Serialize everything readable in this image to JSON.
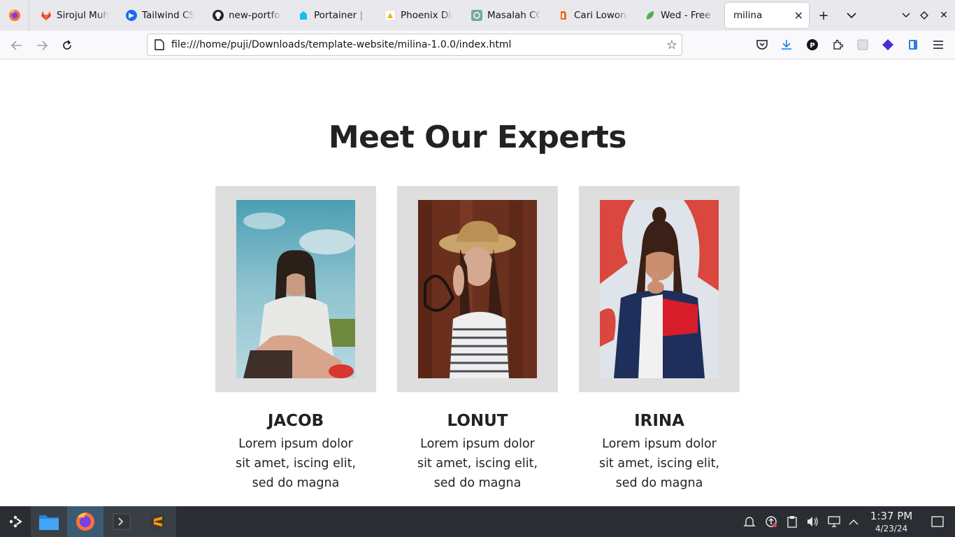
{
  "browser": {
    "tabs": [
      {
        "title": "Sirojul Muhtar",
        "favicon": "gitlab-icon",
        "color": "#e24329"
      },
      {
        "title": "Tailwind CSS",
        "favicon": "play-circle-icon",
        "color": "#1a6df2"
      },
      {
        "title": "new-portfolio",
        "favicon": "github-icon",
        "color": "#24292f"
      },
      {
        "title": "Portainer | lo",
        "favicon": "portainer-icon",
        "color": "#13bef9"
      },
      {
        "title": "Phoenix Digit",
        "favicon": "phoenix-icon",
        "color": "#f6b01e"
      },
      {
        "title": "Masalah COR",
        "favicon": "chatgpt-icon",
        "color": "#74aa9c"
      },
      {
        "title": "Cari Lowonga",
        "favicon": "jobsite-icon",
        "color": "#f26b1d"
      },
      {
        "title": "Wed - Free B",
        "favicon": "leaf-icon",
        "color": "#4caf50"
      },
      {
        "title": "milina",
        "favicon": "",
        "color": "#ffffff"
      }
    ],
    "url": "file:///home/puji/Downloads/template-website/milina-1.0.0/index.html"
  },
  "page": {
    "heading": "Meet Our Experts",
    "experts": [
      {
        "name": "JACOB",
        "description": "Lorem ipsum dolor sit amet, iscing elit, sed do magna"
      },
      {
        "name": "LONUT",
        "description": "Lorem ipsum dolor sit amet, iscing elit, sed do magna"
      },
      {
        "name": "IRINA",
        "description": "Lorem ipsum dolor sit amet, iscing elit, sed do magna"
      }
    ]
  },
  "taskbar": {
    "time": "1:37 PM",
    "date": "4/23/24",
    "accent": "#3d5a73"
  }
}
